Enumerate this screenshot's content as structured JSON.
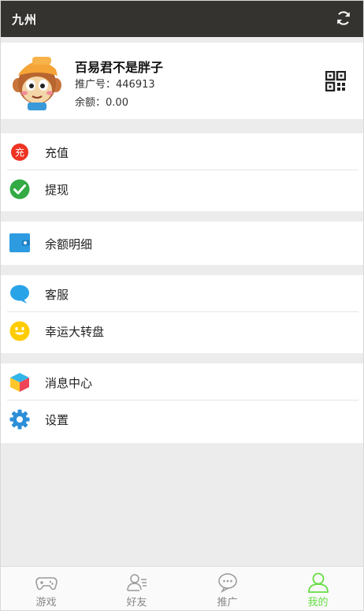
{
  "header": {
    "title": "九州",
    "refresh_icon": "refresh-icon"
  },
  "profile": {
    "name": "百易君不是胖子",
    "promo_label": "推广号：",
    "promo_id": "446913",
    "balance_label": "余额：",
    "balance": "0.00",
    "avatar_icon": "monkey-avatar",
    "qr_icon": "qr-code-icon"
  },
  "menu": {
    "recharge": {
      "label": "充值",
      "icon_text": "充",
      "icon": "recharge-icon",
      "color": "#ee3322"
    },
    "withdraw": {
      "label": "提现",
      "icon": "check-circle-icon",
      "color": "#33aa44"
    },
    "balance_detail": {
      "label": "余额明细",
      "icon": "wallet-icon",
      "color": "#2d9be0"
    },
    "service": {
      "label": "客服",
      "icon": "chat-bubble-icon",
      "color": "#29a3e8"
    },
    "wheel": {
      "label": "幸运大转盘",
      "icon": "smiley-icon",
      "color": "#ffcc00"
    },
    "messages": {
      "label": "消息中心",
      "icon": "cube-icon"
    },
    "settings": {
      "label": "设置",
      "icon": "gear-icon",
      "color": "#2d8fd8"
    }
  },
  "tabs": [
    {
      "label": "游戏",
      "icon": "gamepad-icon"
    },
    {
      "label": "好友",
      "icon": "friends-icon"
    },
    {
      "label": "推广",
      "icon": "message-dots-icon"
    },
    {
      "label": "我的",
      "icon": "user-icon",
      "active": true
    }
  ],
  "colors": {
    "topbar": "#353330",
    "active_tab": "#66dd44",
    "inactive_tab": "#888888",
    "background": "#ececec"
  }
}
